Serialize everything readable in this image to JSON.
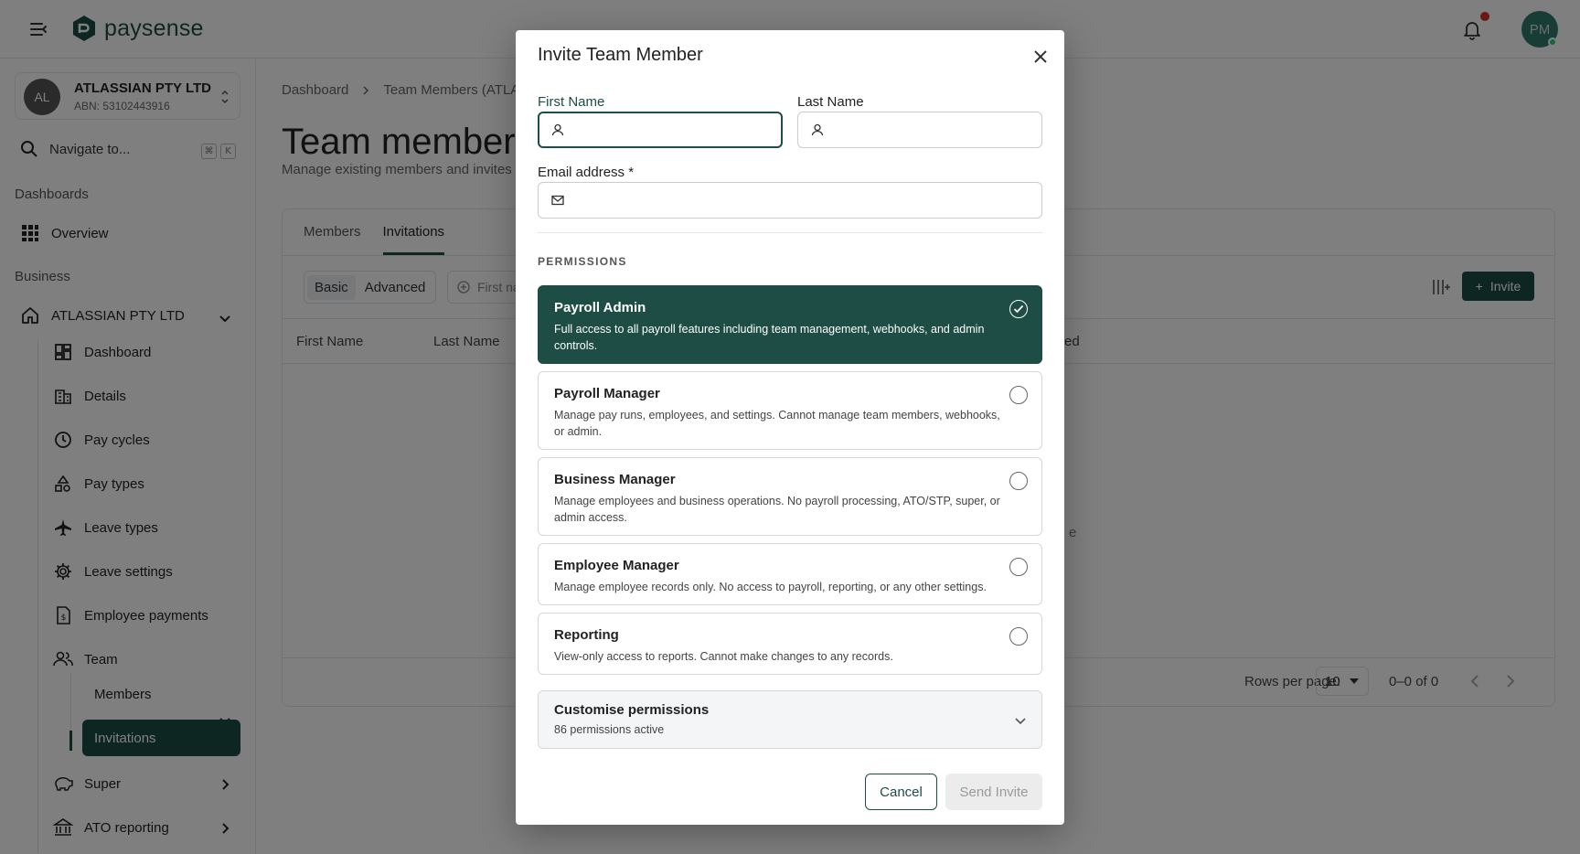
{
  "app": {
    "brand": "paysense",
    "user_initials": "PM"
  },
  "sidebar": {
    "org": {
      "initials": "AL",
      "name": "ATLASSIAN PTY LTD",
      "abn": "ABN: 53102443916"
    },
    "search_label": "Navigate to...",
    "shortcut_keys": [
      "⌘",
      "K"
    ],
    "sections": {
      "dashboards": "Dashboards",
      "business": "Business"
    },
    "overview": "Overview",
    "business_org": "ATLASSIAN PTY LTD",
    "items": [
      {
        "label": "Dashboard",
        "icon": "dashboard-icon"
      },
      {
        "label": "Details",
        "icon": "building-icon"
      },
      {
        "label": "Pay cycles",
        "icon": "clock-icon"
      },
      {
        "label": "Pay types",
        "icon": "shapes-icon"
      },
      {
        "label": "Leave types",
        "icon": "plane-icon"
      },
      {
        "label": "Leave settings",
        "icon": "gear-icon"
      },
      {
        "label": "Employee payments",
        "icon": "receipt-icon"
      },
      {
        "label": "Team",
        "icon": "team-icon"
      },
      {
        "label": "Super",
        "icon": "piggy-bank-icon"
      },
      {
        "label": "ATO reporting",
        "icon": "bank-icon"
      }
    ],
    "team_sub": {
      "members": "Members",
      "invitations": "Invitations"
    }
  },
  "main": {
    "breadcrumb": [
      "Dashboard",
      "Team Members (ATLA"
    ],
    "title": "Team members",
    "subtitle": "Manage existing members and invites",
    "tabs": [
      {
        "label": "Members"
      },
      {
        "label": "Invitations",
        "active": true
      }
    ],
    "segment": {
      "basic": "Basic",
      "advanced": "Advanced"
    },
    "filter_placeholder": "First nan",
    "invite_label": "Invite",
    "columns": [
      "First Name",
      "Last Name",
      "ed"
    ],
    "empty_fragment": "e",
    "pager": {
      "label": "Rows per page:",
      "value": "10",
      "count": "0–0 of 0"
    }
  },
  "modal": {
    "title": "Invite Team Member",
    "first_name_label": "First Name",
    "first_name_value": "",
    "last_name_label": "Last Name",
    "last_name_value": "",
    "email_label": "Email address *",
    "email_value": "",
    "permissions_heading": "PERMISSIONS",
    "roles": [
      {
        "title": "Payroll Admin",
        "desc": "Full access to all payroll features including team management, webhooks, and admin controls.",
        "selected": true
      },
      {
        "title": "Payroll Manager",
        "desc": "Manage pay runs, employees, and settings. Cannot manage team members, webhooks, or admin.",
        "selected": false
      },
      {
        "title": "Business Manager",
        "desc": "Manage employees and business operations. No payroll processing, ATO/STP, super, or admin access.",
        "selected": false
      },
      {
        "title": "Employee Manager",
        "desc": "Manage employee records only. No access to payroll, reporting, or any other settings.",
        "selected": false
      },
      {
        "title": "Reporting",
        "desc": "View-only access to reports. Cannot make changes to any records.",
        "selected": false
      }
    ],
    "customise": {
      "title": "Customise permissions",
      "subtitle": "86 permissions active"
    },
    "cancel_label": "Cancel",
    "send_label": "Send Invite"
  },
  "colors": {
    "brand": "#1d4d44",
    "notification": "#d93025",
    "online": "#2ecc71"
  }
}
